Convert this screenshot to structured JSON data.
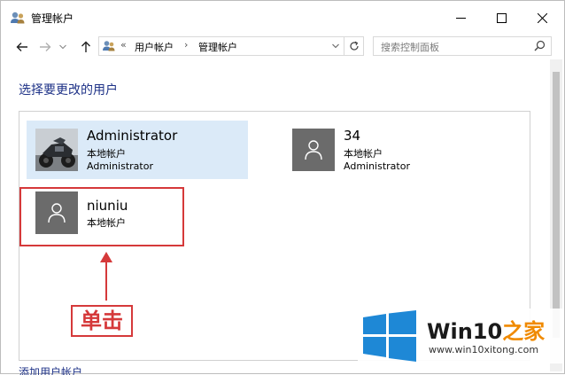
{
  "window": {
    "title": "管理帐户"
  },
  "address": {
    "segments": [
      "用户帐户",
      "管理帐户"
    ],
    "prefix": "«",
    "separator": "›"
  },
  "search": {
    "placeholder": "搜索控制面板"
  },
  "page": {
    "heading": "选择要更改的用户"
  },
  "accounts": [
    {
      "name": "Administrator",
      "type": "本地帐户",
      "role": "Administrator",
      "picture": "motorcycle-photo",
      "selected": true
    },
    {
      "name": "34",
      "type": "本地帐户",
      "role": "Administrator",
      "picture": "default-user-icon",
      "selected": false
    },
    {
      "name": "niuniu",
      "type": "本地帐户",
      "picture": "default-user-icon",
      "selected": false
    }
  ],
  "annotation": {
    "label": "单击",
    "color": "#d5393a"
  },
  "bottom_link_partial": "添加用户帐户",
  "watermark": {
    "brand_main": "Win10",
    "brand_accent": "之家",
    "url": "www.win10xitong.com"
  },
  "colors": {
    "heading": "#1e3287",
    "selected_tile": "#dbeaf8",
    "annotation": "#d5393a",
    "win_logo": "#1e88d6",
    "brand_accent": "#f08a00"
  }
}
